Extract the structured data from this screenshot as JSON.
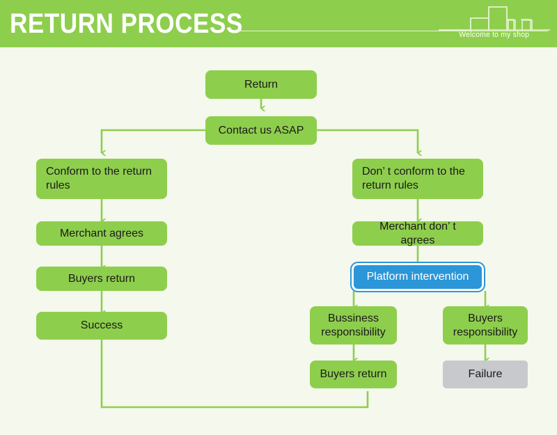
{
  "header": {
    "title": "RETURN PROCESS",
    "tagline": "Welcome to my shop",
    "skyline_icon": "city-skyline-icon",
    "bg_color": "#8ece4d",
    "text_color": "#ffffff"
  },
  "canvas": {
    "bg_color": "#f5f8ed",
    "node_color": "#8ece4d",
    "highlight_color": "#2b96d8",
    "muted_color": "#c8c9cd",
    "connector_color": "#8ece4d"
  },
  "nodes": {
    "return": "Return",
    "contact": "Contact us ASAP",
    "conform": "Conform to the return rules",
    "merchant_agrees": "Merchant agrees",
    "buyers_return_left": "Buyers return",
    "success": "Success",
    "not_conform": "Don’ t conform to the return rules",
    "merchant_not_agrees": "Merchant don’ t agrees",
    "platform": "Platform intervention",
    "business_resp": "Bussiness responsibility",
    "buyers_resp": "Buyers responsibility",
    "buyers_return_right": "Buyers return",
    "failure": "Failure"
  }
}
